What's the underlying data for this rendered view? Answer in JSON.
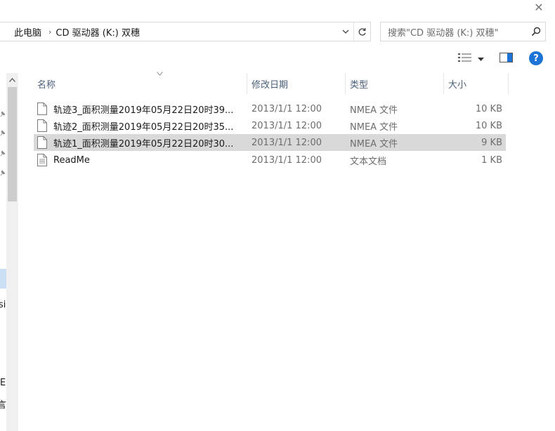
{
  "window": {
    "close_glyph": "✕"
  },
  "address": {
    "crumbs": [
      "此电脑",
      "CD 驱动器 (K:) 双穗"
    ],
    "separator": "›",
    "dropdown_glyph": "⌄",
    "refresh_glyph": "↻"
  },
  "search": {
    "placeholder": "搜索\"CD 驱动器 (K:) 双穗\""
  },
  "toolbar": {
    "help_label": "?"
  },
  "nav": {
    "partial_text_1": "si",
    "partial_text_2": "E",
    "partial_text_3": "言"
  },
  "columns": {
    "name": "名称",
    "date": "修改日期",
    "type": "类型",
    "size": "大小"
  },
  "files": [
    {
      "name": "轨迹3_面积测量2019年05月22日20时39...",
      "date": "2013/1/1 12:00",
      "type": "NMEA 文件",
      "size": "10 KB",
      "icon": "blank-file-icon",
      "selected": false
    },
    {
      "name": "轨迹2_面积测量2019年05月22日20时35...",
      "date": "2013/1/1 12:00",
      "type": "NMEA 文件",
      "size": "10 KB",
      "icon": "blank-file-icon",
      "selected": false
    },
    {
      "name": "轨迹1_面积测量2019年05月22日20时30...",
      "date": "2013/1/1 12:00",
      "type": "NMEA 文件",
      "size": "9 KB",
      "icon": "blank-file-icon",
      "selected": true
    },
    {
      "name": "ReadMe",
      "date": "2013/1/1 12:00",
      "type": "文本文档",
      "size": "1 KB",
      "icon": "text-file-icon",
      "selected": false
    }
  ],
  "colors": {
    "accent": "#1e73d6",
    "selection": "#d9d9d9",
    "header_text": "#4c607a"
  }
}
